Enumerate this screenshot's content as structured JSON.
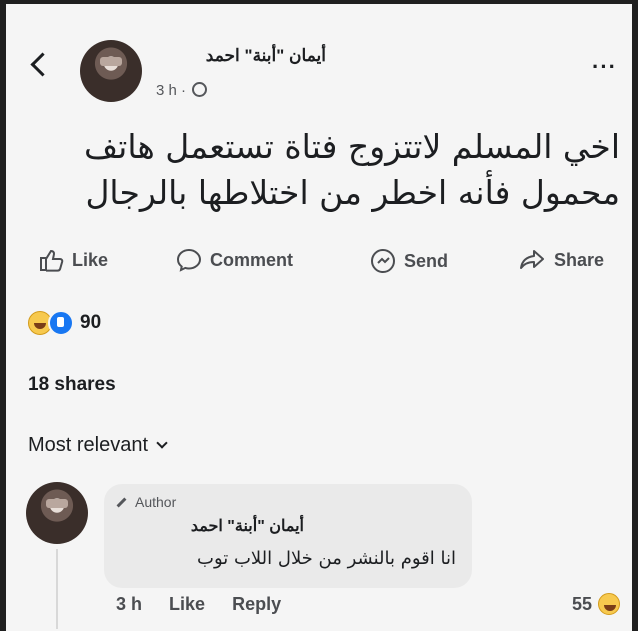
{
  "post": {
    "author": "أيمان \"أبنة\" احمد",
    "time": "3 h ·",
    "text": "اخي المسلم لاتتزوج فتاة تستعمل هاتف محمول فأنه اخطر من اختلاطها بالرجال"
  },
  "actions": {
    "like": "Like",
    "comment": "Comment",
    "send": "Send",
    "share": "Share"
  },
  "stats": {
    "reactions": "90",
    "shares": "18 shares"
  },
  "sort_label": "Most relevant",
  "comment": {
    "badge": "Author",
    "author": "أيمان \"أبنة\" احمد",
    "text": "انا اقوم بالنشر من خلال اللاب توب",
    "time": "3 h",
    "like": "Like",
    "reply": "Reply",
    "reactions": "55"
  },
  "colors": {
    "background": "#f5f5f5",
    "bubble": "#eaeaea",
    "like_blue": "#1877f2"
  }
}
